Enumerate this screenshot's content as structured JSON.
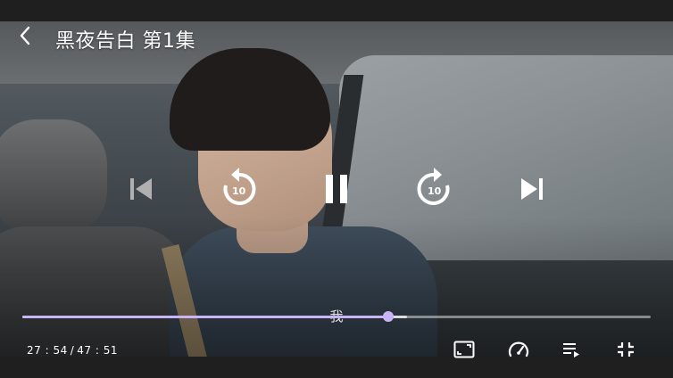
{
  "header": {
    "title": "黑夜告白 第1集"
  },
  "controls": {
    "rewind_seconds": "10",
    "forward_seconds": "10"
  },
  "playback": {
    "current_time": "27 : 54",
    "separator": "/",
    "total_time": "47 : 51",
    "played_fraction": 0.583,
    "buffered_fraction": 0.612,
    "subtitle": "我"
  },
  "icons": {
    "back": "chevron-left-icon",
    "previous": "skip-previous-icon",
    "rewind": "replay-10-icon",
    "pause": "pause-icon",
    "forward": "forward-10-icon",
    "next": "skip-next-icon",
    "aspect": "aspect-ratio-icon",
    "speed": "speed-gauge-icon",
    "playlist": "playlist-icon",
    "exit_fullscreen": "fullscreen-exit-icon"
  },
  "colors": {
    "accent": "#c9b5f5",
    "icon": "#ffffff",
    "icon_disabled": "#b0b0b0"
  }
}
